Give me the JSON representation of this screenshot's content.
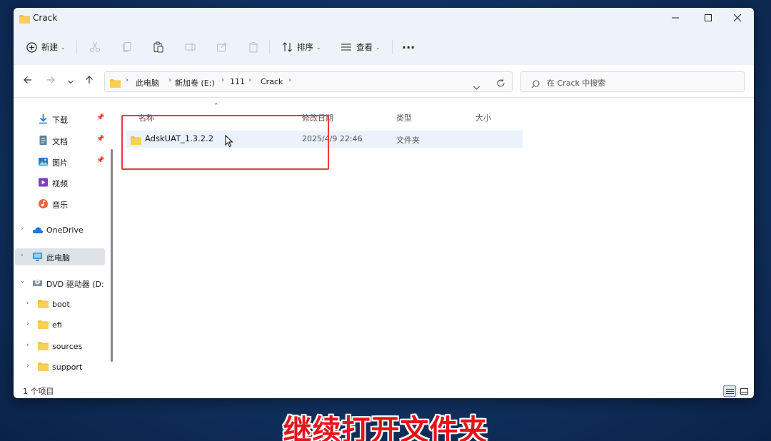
{
  "window": {
    "title": "Crack",
    "controls": {
      "minimize_icon": "minimize-icon",
      "maximize_icon": "maximize-icon",
      "close_icon": "close-icon"
    }
  },
  "toolbar": {
    "new_label": "新建",
    "sort_label": "排序",
    "view_label": "查看",
    "more_label": "···"
  },
  "address": {
    "crumbs": [
      "此电脑",
      "新加卷 (E:)",
      "111",
      "Crack"
    ]
  },
  "search": {
    "placeholder": "在 Crack 中搜索"
  },
  "sidebar": {
    "quick": [
      {
        "label": "下载",
        "icon": "download-icon"
      },
      {
        "label": "文档",
        "icon": "document-icon"
      },
      {
        "label": "图片",
        "icon": "picture-icon"
      },
      {
        "label": "视频",
        "icon": "video-icon"
      },
      {
        "label": "音乐",
        "icon": "music-icon"
      }
    ],
    "onedrive": "OneDrive",
    "this_pc": "此电脑",
    "dvd": "DVD 驱动器 (D:",
    "dvd_children": [
      "boot",
      "efi",
      "sources",
      "support"
    ]
  },
  "columns": {
    "name": "名称",
    "modified": "修改日期",
    "type": "类型",
    "size": "大小"
  },
  "files": [
    {
      "name": "AdskUAT_1.3.2.2",
      "modified": "2025/4/9 22:46",
      "type": "文件夹",
      "size": ""
    }
  ],
  "status": {
    "count_text": "1 个项目"
  },
  "caption": "继续打开文件夹",
  "colors": {
    "accent": "#0067c0",
    "folder": "#f5c342",
    "highlight_box": "#e63c3c",
    "caption": "#e8131a"
  }
}
